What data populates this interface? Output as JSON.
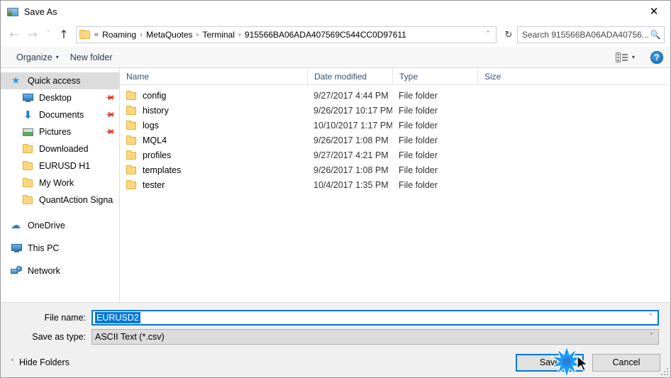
{
  "window": {
    "title": "Save As",
    "app_icon": "contact-card-icon",
    "close_label": "✕"
  },
  "navigation": {
    "back_icon": "←",
    "forward_icon": "→",
    "recent_icon": "ˇ",
    "up_icon": "↑",
    "back_enabled": false,
    "forward_enabled": false,
    "up_enabled": true
  },
  "address_bar": {
    "folder_icon": "folder-icon",
    "lead_separator": "«",
    "crumbs": [
      "Roaming",
      "MetaQuotes",
      "Terminal",
      "915566BA06ADA407569C544CC0D97611"
    ],
    "separator": "›",
    "dropdown_icon": "ˇ",
    "refresh_icon": "↻"
  },
  "search": {
    "placeholder": "Search 915566BA06ADA40756...",
    "icon": "search-icon"
  },
  "toolbar": {
    "organize_label": "Organize",
    "organize_caret": "▾",
    "new_folder_label": "New folder",
    "view_icon": "view-layout-icon",
    "view_caret": "▾",
    "help_label": "?"
  },
  "sidebar": {
    "groups": [
      {
        "name": "quick-access",
        "header": {
          "label": "Quick access",
          "icon": "star-pin-icon",
          "selected": true
        },
        "items": [
          {
            "label": "Desktop",
            "icon": "desktop-icon",
            "pinned": true
          },
          {
            "label": "Documents",
            "icon": "documents-download-icon",
            "pinned": true
          },
          {
            "label": "Pictures",
            "icon": "pictures-icon",
            "pinned": true
          },
          {
            "label": "Downloaded",
            "icon": "folder-icon",
            "pinned": false
          },
          {
            "label": "EURUSD H1",
            "icon": "folder-icon",
            "pinned": false
          },
          {
            "label": "My Work",
            "icon": "folder-icon",
            "pinned": false
          },
          {
            "label": "QuantAction Signal",
            "icon": "folder-icon",
            "pinned": false
          }
        ]
      },
      {
        "name": "locations",
        "items": [
          {
            "label": "OneDrive",
            "icon": "cloud-icon",
            "pinned": false
          },
          {
            "label": "This PC",
            "icon": "monitor-icon",
            "pinned": false
          },
          {
            "label": "Network",
            "icon": "network-icon",
            "pinned": false
          }
        ]
      }
    ]
  },
  "file_list": {
    "columns": [
      "Name",
      "Date modified",
      "Type",
      "Size"
    ],
    "sort_column": "Name",
    "sort_caret": "˄",
    "rows": [
      {
        "name": "config",
        "date": "9/27/2017 4:44 PM",
        "type": "File folder",
        "size": ""
      },
      {
        "name": "history",
        "date": "9/26/2017 10:17 PM",
        "type": "File folder",
        "size": ""
      },
      {
        "name": "logs",
        "date": "10/10/2017 1:17 PM",
        "type": "File folder",
        "size": ""
      },
      {
        "name": "MQL4",
        "date": "9/26/2017 1:08 PM",
        "type": "File folder",
        "size": ""
      },
      {
        "name": "profiles",
        "date": "9/27/2017 4:21 PM",
        "type": "File folder",
        "size": ""
      },
      {
        "name": "templates",
        "date": "9/26/2017 1:08 PM",
        "type": "File folder",
        "size": ""
      },
      {
        "name": "tester",
        "date": "10/4/2017 1:35 PM",
        "type": "File folder",
        "size": ""
      }
    ]
  },
  "form": {
    "file_name_label": "File name:",
    "file_name_value": "EURUSD2",
    "file_name_focused": true,
    "file_name_caret": "ˇ",
    "save_as_type_label": "Save as type:",
    "save_as_type_value": "ASCII Text (*.csv)",
    "save_as_type_caret": "ˇ"
  },
  "footer": {
    "hide_folders_label": "Hide Folders",
    "hide_folders_caret": "˄",
    "save_label": "Save",
    "cancel_label": "Cancel",
    "save_is_default": true,
    "click_indicator": "click-burst-on-save"
  },
  "colors": {
    "accent": "#0078d7",
    "folder": "#fcd77f",
    "selection": "#0078d7",
    "sidebar_selected": "#dcdcdc",
    "burst": "#1a9bff"
  }
}
